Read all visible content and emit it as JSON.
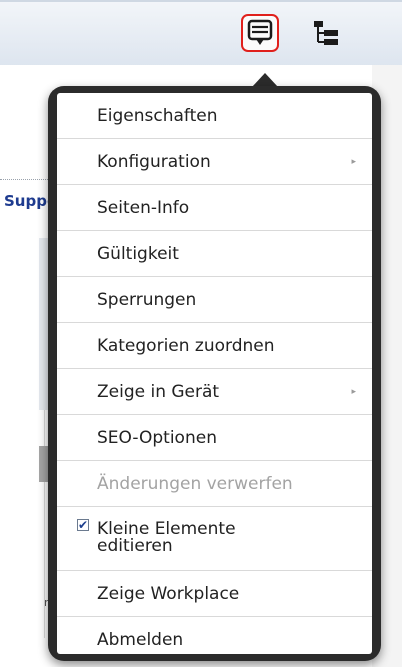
{
  "toolbar": {
    "active_button_icon": "context-menu-icon",
    "sitemap_button_icon": "sitemap-icon",
    "active_border_color": "#e0201c"
  },
  "background": {
    "support_text": "Suppo",
    "fragment_text": "nt"
  },
  "menu": {
    "items": [
      {
        "label": "Eigenschaften"
      },
      {
        "label": "Konfiguration",
        "has_submenu": true
      },
      {
        "label": "Seiten-Info"
      },
      {
        "label": "Gültigkeit"
      },
      {
        "label": "Sperrungen"
      },
      {
        "label": "Kategorien zuordnen"
      },
      {
        "label": "Zeige in Gerät",
        "has_submenu": true
      },
      {
        "label": "SEO-Optionen"
      },
      {
        "label": "Änderungen verwerfen",
        "disabled": true
      },
      {
        "label_line1": "Kleine Elemente",
        "label_line2": "editieren",
        "checked": true
      },
      {
        "label": "Zeige Workplace"
      },
      {
        "label": "Abmelden"
      }
    ],
    "submenu_arrow": "▸",
    "check_mark": "✔"
  }
}
